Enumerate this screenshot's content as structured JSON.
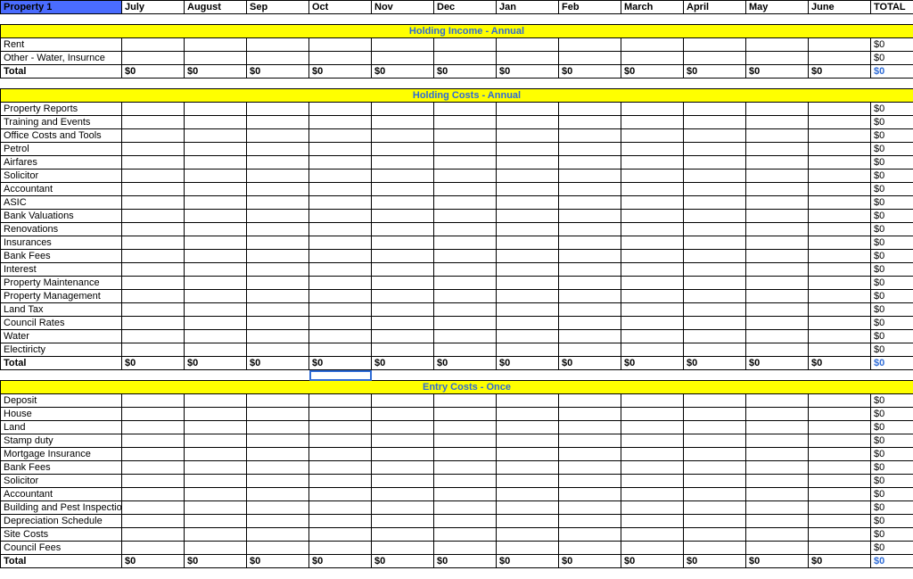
{
  "header": {
    "property": "Property 1",
    "months": [
      "July",
      "August",
      "Sep",
      "Oct",
      "Nov",
      "Dec",
      "Jan",
      "Feb",
      "March",
      "April",
      "May",
      "June"
    ],
    "total_label": "TOTAL"
  },
  "sections": [
    {
      "title": "Holding Income - Annual",
      "rows": [
        {
          "label": "Rent",
          "vals": [
            "",
            "",
            "",
            "",
            "",
            "",
            "",
            "",
            "",
            "",
            "",
            ""
          ],
          "total": "$0"
        },
        {
          "label": "Other - Water, Insurnce",
          "vals": [
            "",
            "",
            "",
            "",
            "",
            "",
            "",
            "",
            "",
            "",
            "",
            ""
          ],
          "total": "$0"
        }
      ],
      "total": {
        "label": "Total",
        "vals": [
          "$0",
          "$0",
          "$0",
          "$0",
          "$0",
          "$0",
          "$0",
          "$0",
          "$0",
          "$0",
          "$0",
          "$0"
        ],
        "grand": "$0"
      }
    },
    {
      "title": "Holding Costs - Annual",
      "rows": [
        {
          "label": "Property Reports",
          "vals": [
            "",
            "",
            "",
            "",
            "",
            "",
            "",
            "",
            "",
            "",
            "",
            ""
          ],
          "total": "$0"
        },
        {
          "label": "Training and Events",
          "vals": [
            "",
            "",
            "",
            "",
            "",
            "",
            "",
            "",
            "",
            "",
            "",
            ""
          ],
          "total": "$0"
        },
        {
          "label": "Office Costs and Tools",
          "vals": [
            "",
            "",
            "",
            "",
            "",
            "",
            "",
            "",
            "",
            "",
            "",
            ""
          ],
          "total": "$0"
        },
        {
          "label": "Petrol",
          "vals": [
            "",
            "",
            "",
            "",
            "",
            "",
            "",
            "",
            "",
            "",
            "",
            ""
          ],
          "total": "$0"
        },
        {
          "label": "Airfares",
          "vals": [
            "",
            "",
            "",
            "",
            "",
            "",
            "",
            "",
            "",
            "",
            "",
            ""
          ],
          "total": "$0"
        },
        {
          "label": "Solicitor",
          "vals": [
            "",
            "",
            "",
            "",
            "",
            "",
            "",
            "",
            "",
            "",
            "",
            ""
          ],
          "total": "$0"
        },
        {
          "label": "Accountant",
          "vals": [
            "",
            "",
            "",
            "",
            "",
            "",
            "",
            "",
            "",
            "",
            "",
            ""
          ],
          "total": "$0"
        },
        {
          "label": "ASIC",
          "vals": [
            "",
            "",
            "",
            "",
            "",
            "",
            "",
            "",
            "",
            "",
            "",
            ""
          ],
          "total": "$0"
        },
        {
          "label": "Bank Valuations",
          "vals": [
            "",
            "",
            "",
            "",
            "",
            "",
            "",
            "",
            "",
            "",
            "",
            ""
          ],
          "total": "$0"
        },
        {
          "label": "Renovations",
          "vals": [
            "",
            "",
            "",
            "",
            "",
            "",
            "",
            "",
            "",
            "",
            "",
            ""
          ],
          "total": "$0"
        },
        {
          "label": "Insurances",
          "vals": [
            "",
            "",
            "",
            "",
            "",
            "",
            "",
            "",
            "",
            "",
            "",
            ""
          ],
          "total": "$0"
        },
        {
          "label": "Bank Fees",
          "vals": [
            "",
            "",
            "",
            "",
            "",
            "",
            "",
            "",
            "",
            "",
            "",
            ""
          ],
          "total": "$0"
        },
        {
          "label": "Interest",
          "vals": [
            "",
            "",
            "",
            "",
            "",
            "",
            "",
            "",
            "",
            "",
            "",
            ""
          ],
          "total": "$0"
        },
        {
          "label": "Property Maintenance",
          "vals": [
            "",
            "",
            "",
            "",
            "",
            "",
            "",
            "",
            "",
            "",
            "",
            ""
          ],
          "total": "$0"
        },
        {
          "label": "Property Management",
          "vals": [
            "",
            "",
            "",
            "",
            "",
            "",
            "",
            "",
            "",
            "",
            "",
            ""
          ],
          "total": "$0"
        },
        {
          "label": "Land Tax",
          "vals": [
            "",
            "",
            "",
            "",
            "",
            "",
            "",
            "",
            "",
            "",
            "",
            ""
          ],
          "total": "$0"
        },
        {
          "label": "Council Rates",
          "vals": [
            "",
            "",
            "",
            "",
            "",
            "",
            "",
            "",
            "",
            "",
            "",
            ""
          ],
          "total": "$0"
        },
        {
          "label": "Water",
          "vals": [
            "",
            "",
            "",
            "",
            "",
            "",
            "",
            "",
            "",
            "",
            "",
            ""
          ],
          "total": "$0"
        },
        {
          "label": "Electiricty",
          "vals": [
            "",
            "",
            "",
            "",
            "",
            "",
            "",
            "",
            "",
            "",
            "",
            ""
          ],
          "total": "$0"
        }
      ],
      "total": {
        "label": "Total",
        "vals": [
          "$0",
          "$0",
          "$0",
          "$0",
          "$0",
          "$0",
          "$0",
          "$0",
          "$0",
          "$0",
          "$0",
          "$0"
        ],
        "grand": "$0"
      }
    },
    {
      "title": "Entry Costs - Once",
      "rows": [
        {
          "label": "Deposit",
          "vals": [
            "",
            "",
            "",
            "",
            "",
            "",
            "",
            "",
            "",
            "",
            "",
            ""
          ],
          "total": "$0"
        },
        {
          "label": "House",
          "vals": [
            "",
            "",
            "",
            "",
            "",
            "",
            "",
            "",
            "",
            "",
            "",
            ""
          ],
          "total": "$0"
        },
        {
          "label": "Land",
          "vals": [
            "",
            "",
            "",
            "",
            "",
            "",
            "",
            "",
            "",
            "",
            "",
            ""
          ],
          "total": "$0"
        },
        {
          "label": "Stamp duty",
          "vals": [
            "",
            "",
            "",
            "",
            "",
            "",
            "",
            "",
            "",
            "",
            "",
            ""
          ],
          "total": "$0"
        },
        {
          "label": "Mortgage Insurance",
          "vals": [
            "",
            "",
            "",
            "",
            "",
            "",
            "",
            "",
            "",
            "",
            "",
            ""
          ],
          "total": "$0"
        },
        {
          "label": "Bank Fees",
          "vals": [
            "",
            "",
            "",
            "",
            "",
            "",
            "",
            "",
            "",
            "",
            "",
            ""
          ],
          "total": "$0"
        },
        {
          "label": "Solicitor",
          "vals": [
            "",
            "",
            "",
            "",
            "",
            "",
            "",
            "",
            "",
            "",
            "",
            ""
          ],
          "total": "$0"
        },
        {
          "label": "Accountant",
          "vals": [
            "",
            "",
            "",
            "",
            "",
            "",
            "",
            "",
            "",
            "",
            "",
            ""
          ],
          "total": "$0"
        },
        {
          "label": "Building and Pest Inspection",
          "vals": [
            "",
            "",
            "",
            "",
            "",
            "",
            "",
            "",
            "",
            "",
            "",
            ""
          ],
          "total": "$0"
        },
        {
          "label": "Depreciation Schedule",
          "vals": [
            "",
            "",
            "",
            "",
            "",
            "",
            "",
            "",
            "",
            "",
            "",
            ""
          ],
          "total": "$0"
        },
        {
          "label": "Site Costs",
          "vals": [
            "",
            "",
            "",
            "",
            "",
            "",
            "",
            "",
            "",
            "",
            "",
            ""
          ],
          "total": "$0"
        },
        {
          "label": "Council Fees",
          "vals": [
            "",
            "",
            "",
            "",
            "",
            "",
            "",
            "",
            "",
            "",
            "",
            ""
          ],
          "total": "$0"
        }
      ],
      "total": {
        "label": "Total",
        "vals": [
          "$0",
          "$0",
          "$0",
          "$0",
          "$0",
          "$0",
          "$0",
          "$0",
          "$0",
          "$0",
          "$0",
          "$0"
        ],
        "grand": "$0"
      }
    }
  ],
  "selected_cell_after_section_index": 1
}
